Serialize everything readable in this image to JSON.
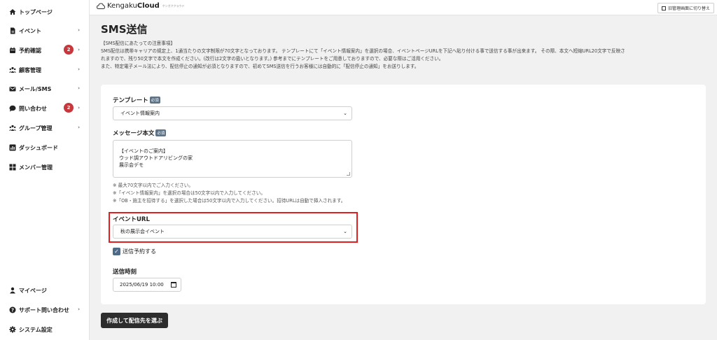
{
  "header": {
    "logo_brand": "Kengaku",
    "logo_cloud": "Cloud",
    "logo_sub": "ケンガククラウド",
    "switch_button": "旧管理画面に切り替え"
  },
  "sidebar": {
    "items": [
      {
        "label": "トップページ",
        "icon": "home-icon"
      },
      {
        "label": "イベント",
        "icon": "document-icon",
        "chevron": "›"
      },
      {
        "label": "予約確認",
        "icon": "calendar-icon",
        "badge": "2",
        "chevron": "›"
      },
      {
        "label": "顧客管理",
        "icon": "users-icon",
        "chevron": "›"
      },
      {
        "label": "メール/SMS",
        "icon": "mail-icon",
        "chevron": "›"
      },
      {
        "label": "問い合わせ",
        "icon": "chat-icon",
        "badge": "2",
        "chevron": "›"
      },
      {
        "label": "グループ管理",
        "icon": "group-icon",
        "chevron": "›"
      },
      {
        "label": "ダッシュボード",
        "icon": "dashboard-icon"
      },
      {
        "label": "メンバー管理",
        "icon": "grid-icon"
      }
    ],
    "bottom_items": [
      {
        "label": "マイページ",
        "icon": "person-icon"
      },
      {
        "label": "サポート問い合わせ",
        "icon": "question-icon",
        "chevron": "›"
      },
      {
        "label": "システム設定",
        "icon": "gear-icon"
      }
    ]
  },
  "main": {
    "title": "SMS送信",
    "notice": [
      "【SMS配信にあたっての注意事項】",
      "SMS配信は携帯キャリアの規定上、1通当たりの文字制限が70文字となっております。 テンプレートにて「イベント情報案内」を選択の場合、イベントページURLを下記へ貼り付ける事で送信する事が出来ます。 その際、本文へ短縮URL20文字で反映さ",
      "れますので、残り50文字で本文を作成ください。(改行は2文字の扱いとなります。) 参考までにテンプレートをご用意しておりますので、必要な際はご活用ください。",
      "また、特定電子メール法により、配信停止の通知が必須となりますので、初めてSMS送信を行うお客様には自動的に「配信停止の通知」をお送りします。"
    ],
    "form": {
      "template_label": "テンプレート",
      "required": "必須",
      "template_value": "イベント情報案内",
      "message_label": "メッセージ本文",
      "message_lines": [
        "【イベントのご案内】",
        "ウッド調アウトドアリビングの家",
        "展示会デモ"
      ],
      "hints": [
        "※ 最大70文字以内でご入力ください。",
        "※「イベント情報案内」を選択の場合は50文字以内で入力してください。",
        "※「OB・施主を招待する」を選択した場合は50文字以内で入力してください。招待URLは自動で挿入されます。"
      ],
      "event_url_label": "イベントURL",
      "event_url_value": "秋の展示会イベント",
      "schedule_checkbox_label": "送信予約する",
      "schedule_checked": true,
      "send_time_label": "送信時刻",
      "send_time_value": "2025/06/19 10:00"
    },
    "submit_button": "作成して配信先を選ぶ"
  },
  "colors": {
    "badge": "#c8373c",
    "required_tag": "#5b7186",
    "checkbox": "#4d6b86",
    "highlight": "#e02020",
    "submit": "#2d2d2d"
  }
}
